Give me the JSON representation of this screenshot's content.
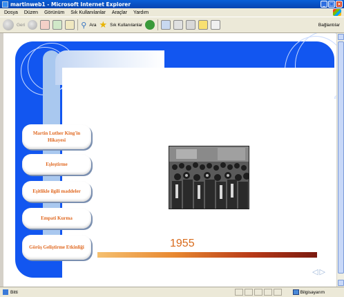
{
  "window": {
    "title": "martinweb1 - Microsoft Internet Explorer",
    "controls": [
      "_",
      "□",
      "×"
    ]
  },
  "menubar": {
    "items": [
      "Dosya",
      "Düzen",
      "Görünüm",
      "Sık Kullanılanlar",
      "Araçlar",
      "Yardım"
    ]
  },
  "toolbar": {
    "back_label": "Geri",
    "search_label": "Ara",
    "favorites_label": "Sık Kullanılanlar",
    "links_label": "Bağlantılar"
  },
  "content": {
    "menu_buttons": [
      {
        "label": "Martin Luther King'in Hikayesi"
      },
      {
        "label": "Eşleştirme"
      },
      {
        "label": "Eşitlikle ilgili maddeler"
      },
      {
        "label": "Empati Kurma"
      },
      {
        "label": "Görüş Geliştirme Etkinliği"
      }
    ],
    "year": "1955",
    "nav_prev": "◁",
    "nav_next": "▷"
  },
  "statusbar": {
    "status_text": "Bitti",
    "zone_text": "Bilgisayarım"
  },
  "colors": {
    "frame_blue": "#1256f0",
    "button_text_orange": "#e06820",
    "year_orange": "#d86a1a"
  }
}
